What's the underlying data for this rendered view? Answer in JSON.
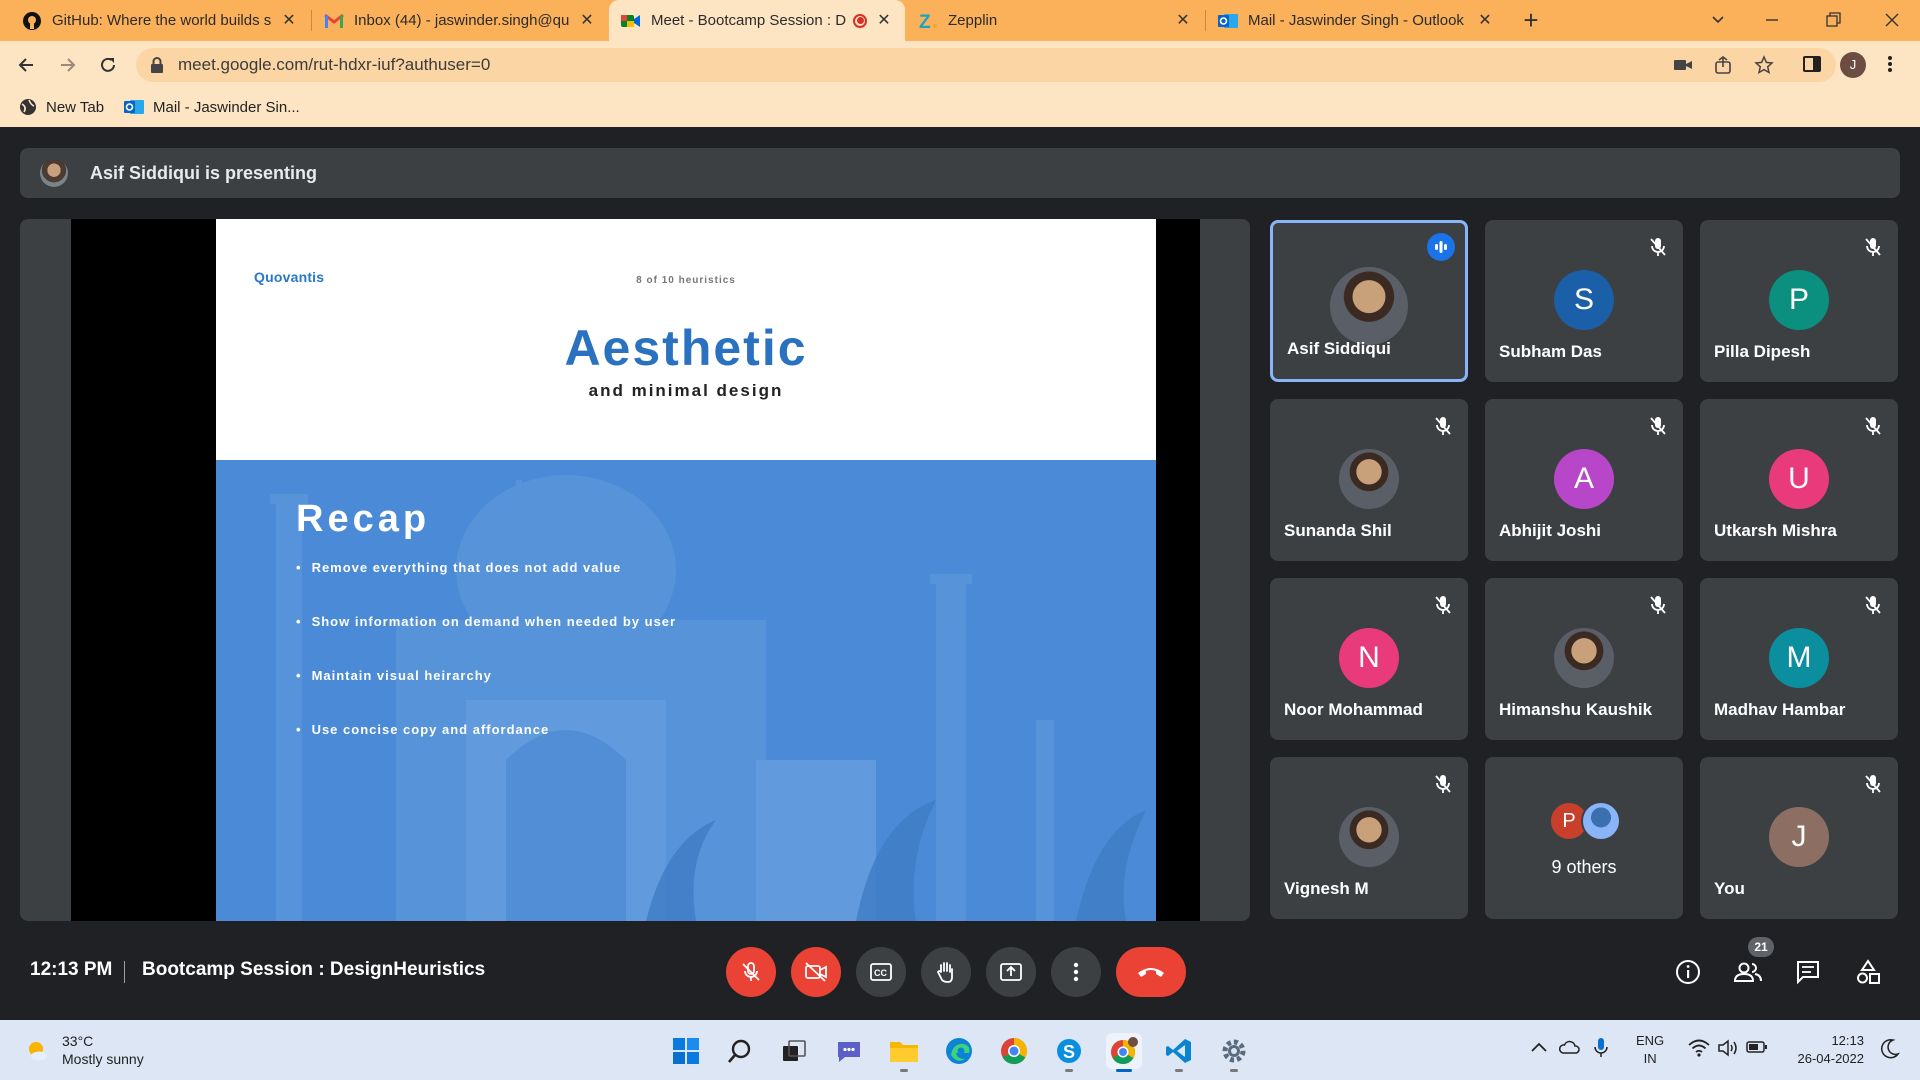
{
  "browser": {
    "tabs": [
      {
        "title": "GitHub: Where the world builds s",
        "icon": "github-icon"
      },
      {
        "title": "Inbox (44) - jaswinder.singh@quo",
        "icon": "gmail-icon"
      },
      {
        "title": "Meet - Bootcamp Session : D",
        "icon": "meet-icon",
        "active": true
      },
      {
        "title": "Zepplin",
        "icon": "zeplin-icon"
      },
      {
        "title": "Mail - Jaswinder Singh - Outlook",
        "icon": "outlook-icon"
      }
    ],
    "url": "meet.google.com/rut-hdxr-iuf?authuser=0",
    "profile_initial": "J",
    "bookmarks": [
      {
        "label": "New Tab",
        "icon": "globe-icon"
      },
      {
        "label": "Mail - Jaswinder Sin...",
        "icon": "outlook-icon"
      }
    ],
    "tab_bar_color": "#fbb15a"
  },
  "meet": {
    "presenting_text": "Asif Siddiqui is presenting",
    "slide": {
      "logo": "Quovantis",
      "counter": "8 of 10 heuristics",
      "title": "Aesthetic",
      "subtitle": "and minimal design",
      "section": "Recap",
      "bullets": [
        "Remove everything that does not add value",
        "Show information on demand when needed by user",
        "Maintain visual heirarchy",
        "Use concise copy and affordance"
      ]
    },
    "participants": [
      {
        "name": "Asif Siddiqui",
        "initial": "",
        "photo": true,
        "speaking": true
      },
      {
        "name": "Subham Das",
        "initial": "S",
        "color": "#1a5fa8"
      },
      {
        "name": "Pilla Dipesh",
        "initial": "P",
        "color": "#0b8f7e"
      },
      {
        "name": "Sunanda Shil",
        "initial": "",
        "photo": true
      },
      {
        "name": "Abhijit Joshi",
        "initial": "A",
        "color": "#b746c9"
      },
      {
        "name": "Utkarsh Mishra",
        "initial": "U",
        "color": "#e93a7b"
      },
      {
        "name": "Noor Mohammad",
        "initial": "N",
        "color": "#e93a7b"
      },
      {
        "name": "Himanshu Kaushik",
        "initial": "",
        "photo": true
      },
      {
        "name": "Madhav Hambar",
        "initial": "M",
        "color": "#0b8f9e"
      },
      {
        "name": "Vignesh M",
        "initial": "",
        "photo": true
      },
      {
        "name": "9 others",
        "others": true,
        "initial": "P",
        "color": "#c8402b"
      },
      {
        "name": "You",
        "initial": "J",
        "color": "#8d6e63"
      }
    ],
    "time": "12:13 PM",
    "meeting_title": "Bootcamp Session : DesignHeuristics",
    "people_count": "21"
  },
  "taskbar": {
    "temperature": "33°C",
    "weather": "Mostly sunny",
    "lang_line1": "ENG",
    "lang_line2": "IN",
    "time": "12:13",
    "date": "26-04-2022"
  }
}
